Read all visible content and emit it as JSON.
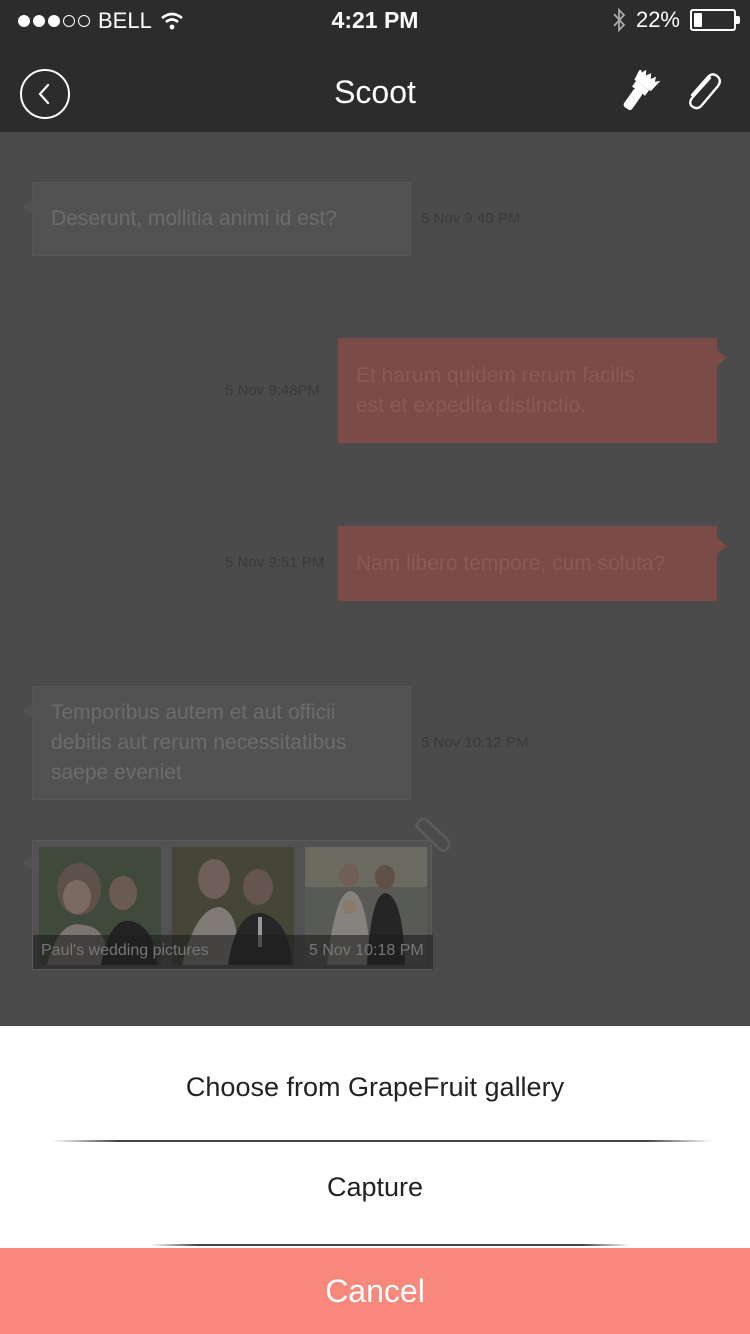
{
  "status_bar": {
    "carrier": "BELL",
    "signal_bars_filled": 3,
    "signal_bars_total": 5,
    "time": "4:21 PM",
    "battery_percent": "22%",
    "battery_level": 0.22,
    "icons": [
      "wifi-icon",
      "bluetooth-icon",
      "battery-icon"
    ]
  },
  "nav": {
    "title": "Scoot",
    "icons": [
      "back-chevron-icon",
      "paint-brush-icon",
      "paperclip-icon"
    ]
  },
  "messages": [
    {
      "direction": "incoming",
      "text": "Deserunt, mollitia animi id est?",
      "timestamp": "5 Nov 9:40 PM"
    },
    {
      "direction": "outgoing",
      "text": "Et harum quidem rerum facilis est et expedita distinctio.",
      "line1": "Et harum quidem rerum facilis",
      "line2": "est et expedita distinctio.",
      "timestamp": "5 Nov 9:48PM"
    },
    {
      "direction": "outgoing",
      "text": "Nam libero tempore, cum soluta?",
      "timestamp": "5 Nov 9:51 PM"
    },
    {
      "direction": "incoming",
      "line1": "Temporibus autem et aut officii",
      "line2": "debitis aut rerum necessitatibus",
      "line3": "saepe eveniet",
      "timestamp": "5 Nov 10:12 PM"
    }
  ],
  "attachment": {
    "caption": "Paul's wedding pictures",
    "timestamp": "5 Nov 10:18 PM"
  },
  "action_sheet": {
    "option_gallery": "Choose from GrapeFruit gallery",
    "option_capture": "Capture",
    "cancel": "Cancel",
    "cancel_color": "#f8877c"
  }
}
